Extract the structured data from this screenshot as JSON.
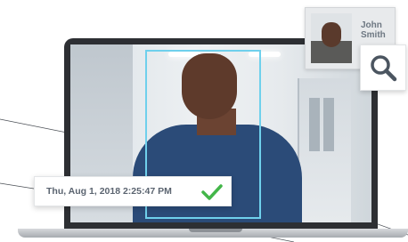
{
  "id_card": {
    "first_name": "John",
    "last_name": "Smith",
    "photo_icon": "person-portrait"
  },
  "search": {
    "icon": "search-icon"
  },
  "timestamp": {
    "text": "Thu, Aug 1, 2018 2:25:47 PM",
    "status_icon": "check-icon",
    "status_color": "#43b649"
  },
  "camera": {
    "face_box_color": "#6fd0ec"
  }
}
